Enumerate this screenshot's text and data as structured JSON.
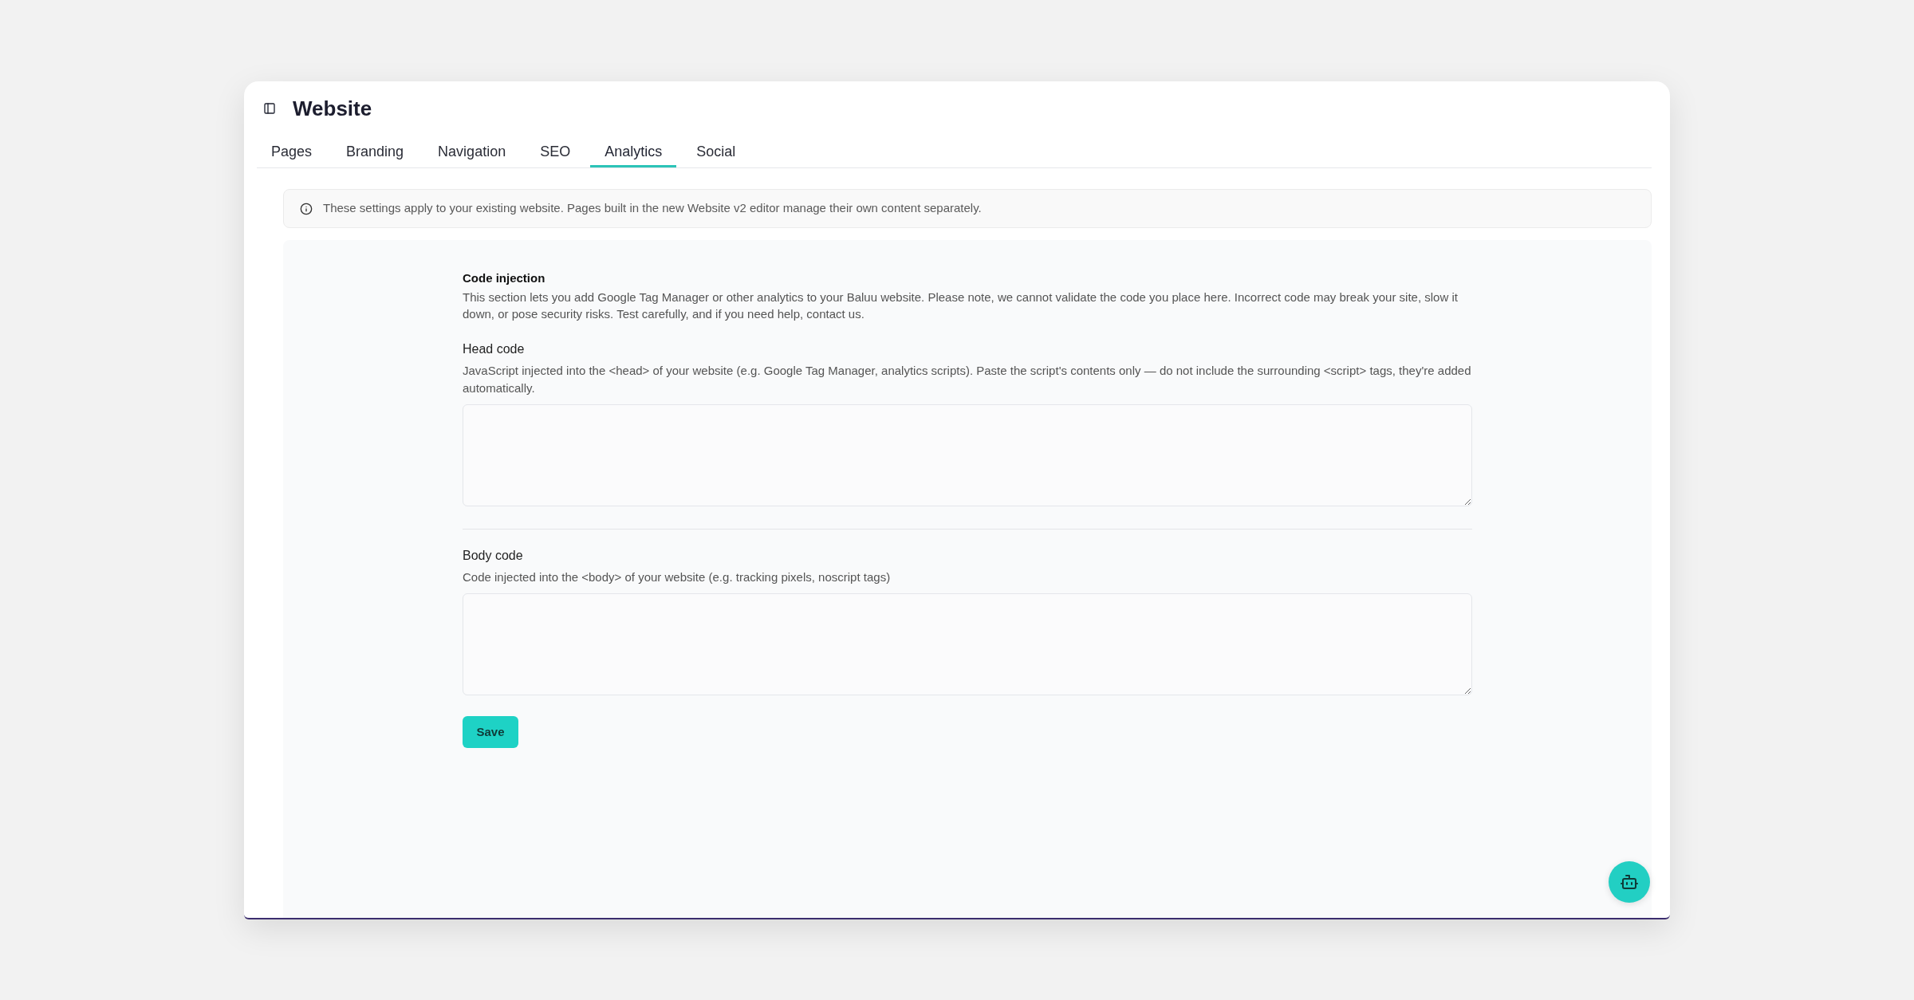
{
  "header": {
    "title": "Website"
  },
  "tabs": [
    {
      "label": "Pages",
      "selected": false
    },
    {
      "label": "Branding",
      "selected": false
    },
    {
      "label": "Navigation",
      "selected": false
    },
    {
      "label": "SEO",
      "selected": false
    },
    {
      "label": "Analytics",
      "selected": true
    },
    {
      "label": "Social",
      "selected": false
    }
  ],
  "notice": {
    "text": "These settings apply to your existing website. Pages built in the new Website v2 editor manage their own content separately."
  },
  "code_injection": {
    "title": "Code injection",
    "description": "This section lets you add Google Tag Manager or other analytics to your Baluu website. Please note, we cannot validate the code you place here. Incorrect code may break your site, slow it down, or pose security risks. Test carefully, and if you need help, contact us.",
    "fields": [
      {
        "label": "Head code",
        "description": "JavaScript injected into the <head> of your website (e.g. Google Tag Manager, analytics scripts). Paste the script's contents only — do not include the surrounding <script> tags, they're added automatically."
      },
      {
        "label": "Body code",
        "description": "Code injected into the <body> of your website (e.g. tracking pixels, noscript tags)"
      }
    ],
    "save_button": "Save"
  }
}
